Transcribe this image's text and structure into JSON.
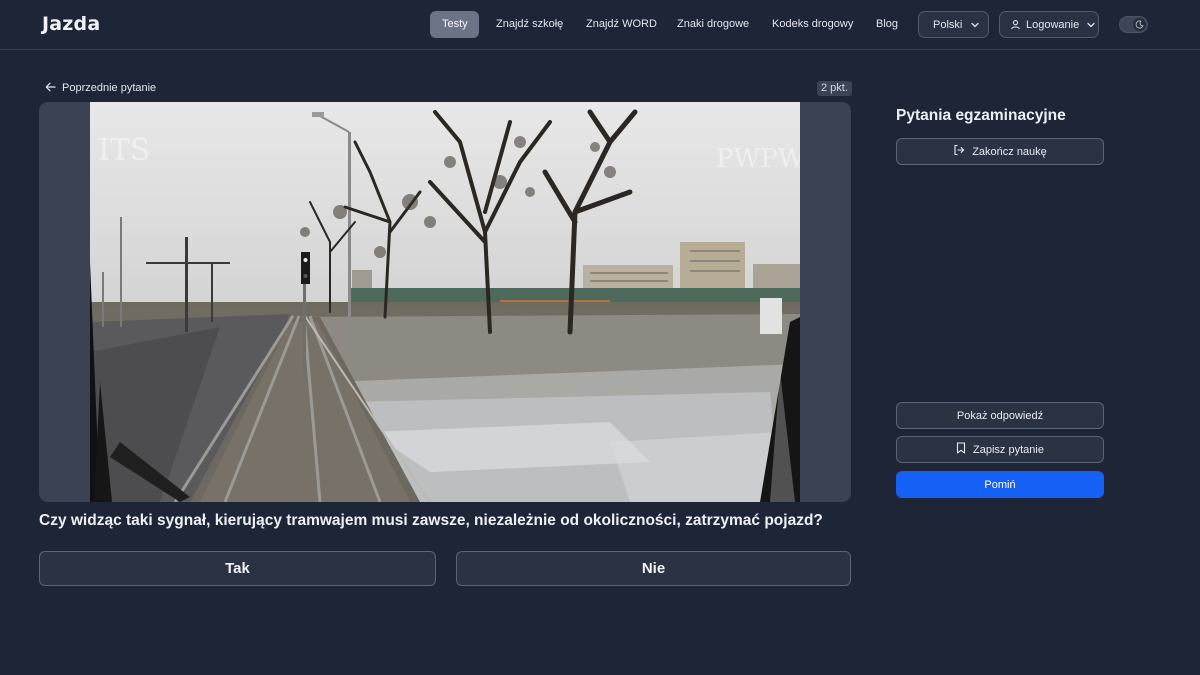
{
  "brand": {
    "logo": "Jazda"
  },
  "nav": {
    "links": [
      "Testy",
      "Znajdź szkołę",
      "Znajdź WORD",
      "Znaki drogowe",
      "Kodeks drogowy",
      "Blog"
    ],
    "active": "Testy",
    "language": "Polski",
    "login": "Logowanie",
    "theme_toggle_icon": "moon-icon"
  },
  "question_panel": {
    "back_label": "Poprzednie pytanie",
    "points": "2 pkt.",
    "watermark_left": "ITS",
    "watermark_right": "PWPW",
    "question_text": "Czy widząc taki sygnał, kierujący tramwajem musi zawsze, niezależnie od okoliczności, zatrzymać pojazd?",
    "answers": [
      "Tak",
      "Nie"
    ]
  },
  "sidebar": {
    "title": "Pytania egzaminacyjne",
    "finish_label": "Zakończ naukę",
    "show_answer_label": "Pokaż odpowiedź",
    "save_label": "Zapisz pytanie",
    "skip_label": "Pomiń"
  },
  "colors": {
    "background": "#1e2536",
    "primary_button": "#1560f5",
    "active_nav": "#6b7486"
  }
}
